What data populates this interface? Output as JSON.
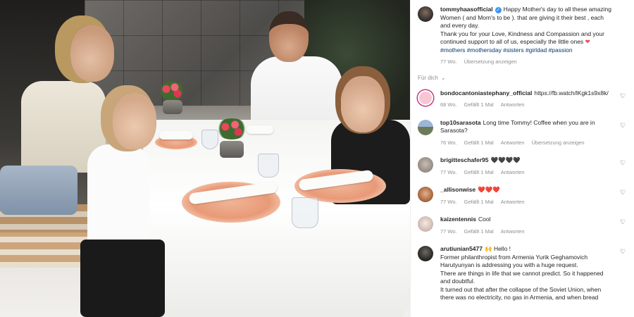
{
  "post": {
    "author": "tommyhaasofficial",
    "verified_mark": "✓",
    "caption_lines": [
      "Happy Mother's day to all these amazing",
      "Women ( and Mom's to be ). that are giving it their best , each",
      "and every day.",
      "Thank you for your Love, Kindness and Compassion and your",
      "continued support to all of us, especially the little ones"
    ],
    "caption_heart": "❤",
    "hashtags": "#mothers #mothersday #sisters #girldad #passion",
    "age": "77 Wo.",
    "translate": "Übersetzung anzeigen"
  },
  "filter": {
    "label": "Für dich",
    "icon": "chevron-down-icon",
    "glyph": "⌄"
  },
  "comments": [
    {
      "user": "bondocantoniastephany_official",
      "text": "https://fb.watch/lKgk1s9x8k/",
      "age": "68 Wo.",
      "likes": "Gefällt 1 Mal",
      "reply": "Antworten",
      "avatar_color": "#f7c6d2"
    },
    {
      "user": "top10sarasota",
      "text": "Long time Tommy! Coffee when you are in",
      "text2": "Sarasota?",
      "age": "76 Wo.",
      "likes": "Gefällt 1 Mal",
      "reply": "Antworten",
      "translate": "Übersetzung anzeigen",
      "avatar_color": "#6c7b5a"
    },
    {
      "user": "brigitteschafer95",
      "text": "🖤🖤🖤🖤",
      "age": "77 Wo.",
      "likes": "Gefällt 1 Mal",
      "reply": "Antworten",
      "avatar_color": "#d9d4cf"
    },
    {
      "user": "_allisonwise",
      "text": "❤️❤️❤️",
      "age": "77 Wo.",
      "likes": "Gefällt 1 Mal",
      "reply": "Antworten",
      "avatar_color": "#c98a5f"
    },
    {
      "user": "kaizentennis",
      "text": "Cool",
      "age": "77 Wo.",
      "likes": "Gefällt 1 Mal",
      "reply": "Antworten",
      "avatar_color": "#e8d8d2"
    },
    {
      "user": "arutiunian5477",
      "text": "🙌 Hello !",
      "lines": [
        "Former philanthropist from Armenia Yurik Geghamovich",
        "Harutyunyan is addressing you with a huge request.",
        "There are things in life that we cannot predict. So it happened",
        "and doubtful.",
        "It turned out that after the collapse of the Soviet Union, when",
        "there was no electricity, no gas in Armenia, and when bread"
      ],
      "avatar_color": "#3b3a36"
    }
  ],
  "like_icon_glyph": "♡"
}
